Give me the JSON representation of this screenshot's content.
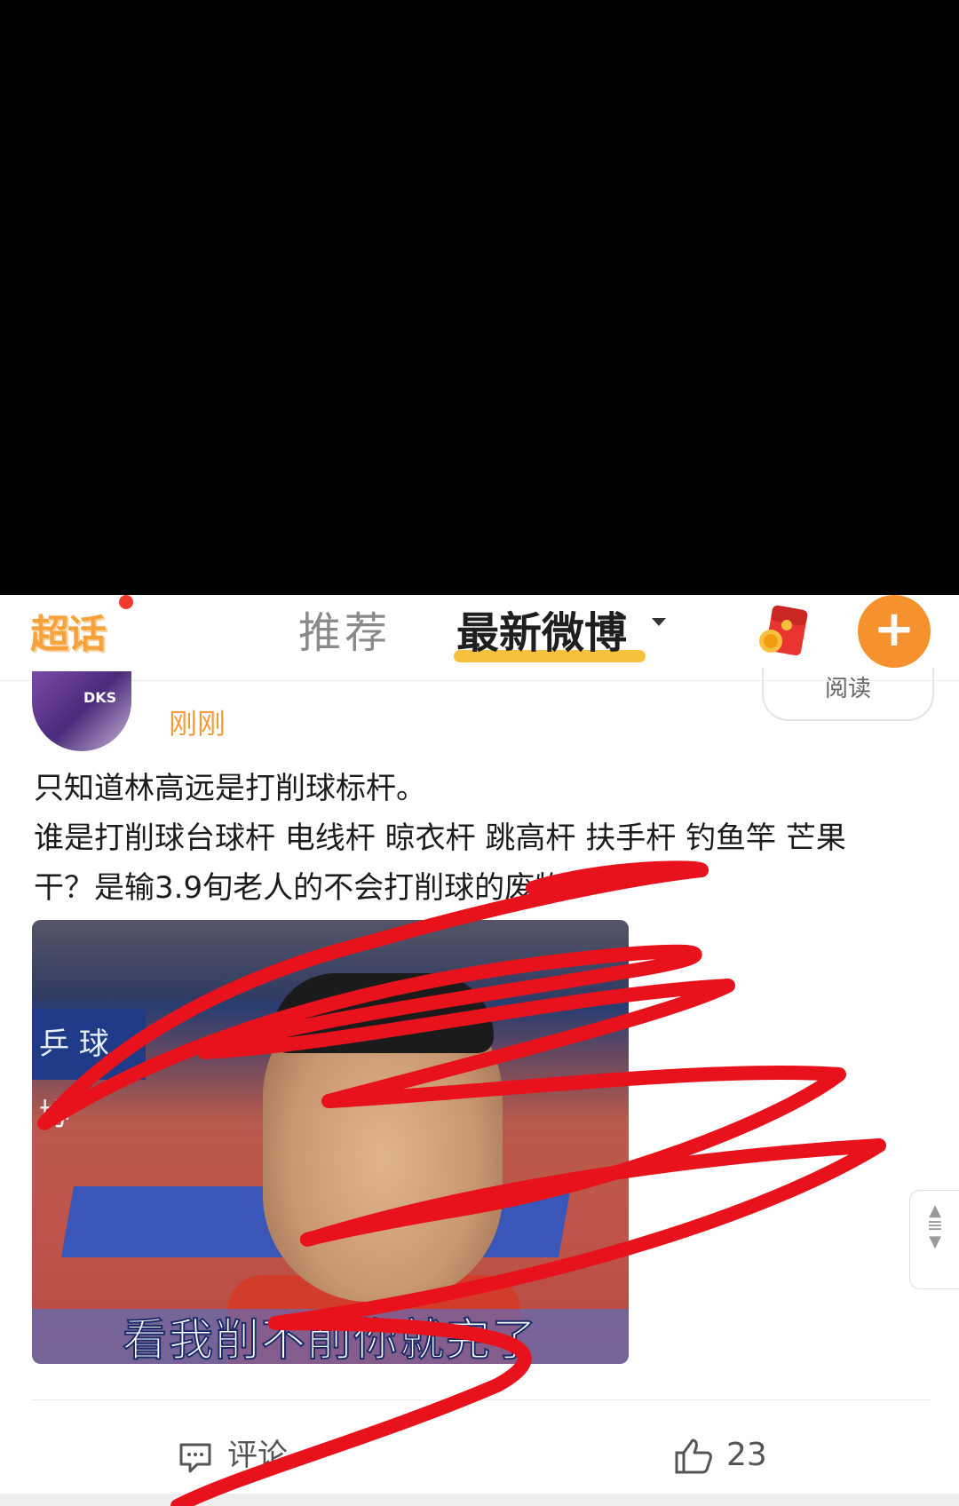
{
  "nav": {
    "logo_text": "超话",
    "tabs": [
      {
        "label": "推荐",
        "active": false
      },
      {
        "label": "最新微博",
        "active": true
      }
    ],
    "plus_label": "+"
  },
  "post": {
    "time": "刚刚",
    "read_label": "阅读",
    "avatar_text": "DKS",
    "text_lines": [
      "只知道林高远是打削球标杆。",
      "谁是打削球台球杆 电线杆 晾衣杆 跳高杆 扶手杆 钓鱼竿 芒果",
      "干？是输3.9旬老人的不会打削球的废物"
    ],
    "image": {
      "banner_text": "乒 球 协",
      "caption": "看我削不削你就完了"
    },
    "actions": {
      "comment_label": "评论",
      "like_count": "23"
    }
  },
  "colors": {
    "accent_orange": "#f6922e",
    "time_orange": "#f29b3a",
    "tab_highlight": "#f7c13f",
    "scribble_red": "#e8121c"
  }
}
